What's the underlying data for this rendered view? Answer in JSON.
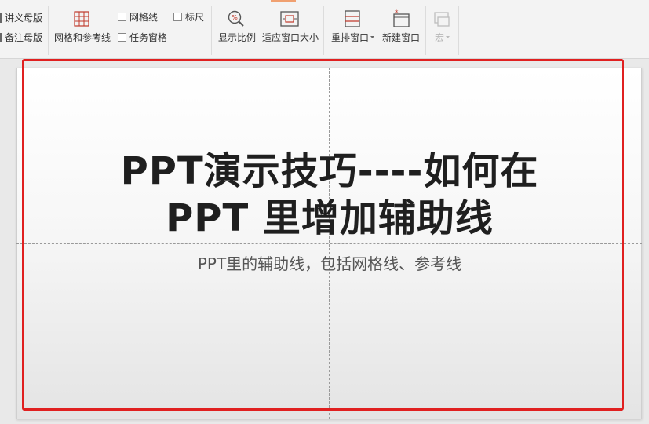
{
  "ribbon": {
    "handout_master": "讲义母版",
    "notes_master": "备注母版",
    "grid_and_guides": "网格和参考线",
    "gridlines": "网格线",
    "ruler": "标尺",
    "task_pane": "任务窗格",
    "zoom": "显示比例",
    "fit_to_window": "适应窗口大小",
    "arrange_windows": "重排窗口",
    "new_window": "新建窗口",
    "macro": "宏"
  },
  "slide": {
    "title_line1": "PPT演示技巧----如何在",
    "title_line2": "PPT 里增加辅助线",
    "subtitle": "PPT里的辅助线，包括网格线、参考线"
  },
  "colors": {
    "highlight": "#e02020",
    "tab_accent": "#f0a070"
  }
}
